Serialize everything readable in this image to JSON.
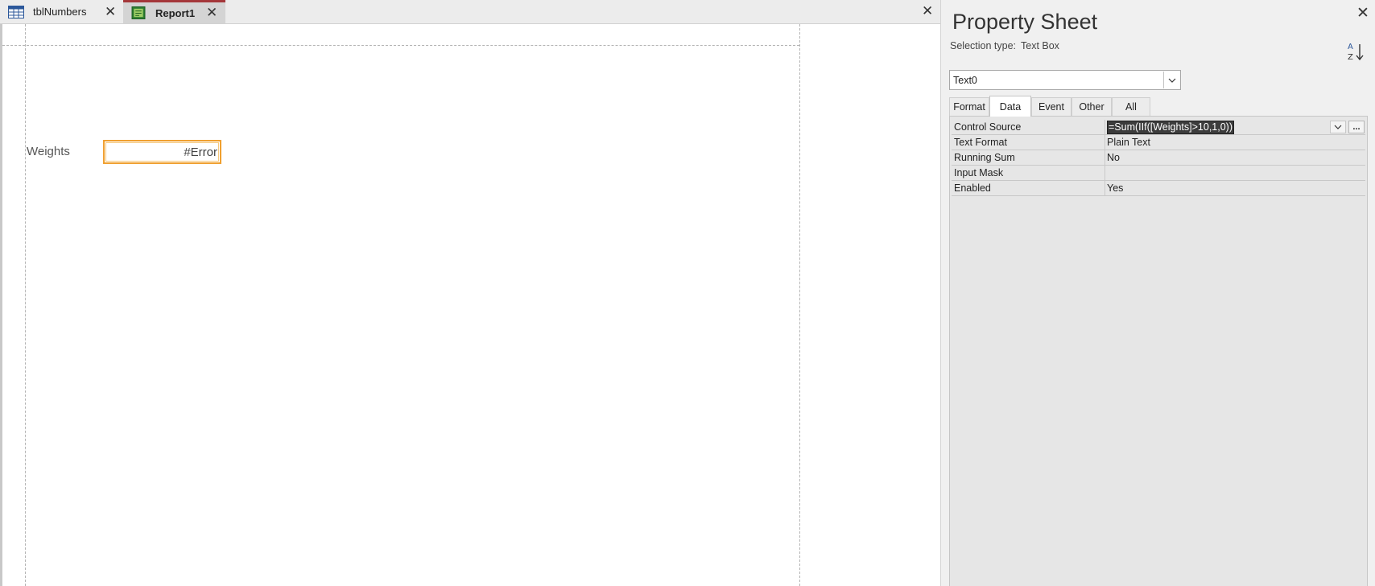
{
  "tabs": [
    {
      "label": "tblNumbers",
      "icon": "table-icon"
    },
    {
      "label": "Report1",
      "icon": "report-icon",
      "active": true
    }
  ],
  "report": {
    "label": "Weights",
    "textbox_value": "#Error"
  },
  "property_sheet": {
    "title": "Property Sheet",
    "selection_label": "Selection type:",
    "selection_type": "Text Box",
    "object_selected": "Text0",
    "tabs": [
      "Format",
      "Data",
      "Event",
      "Other",
      "All"
    ],
    "active_tab": "Data",
    "properties": [
      {
        "name": "Control Source",
        "value": "=Sum(IIf([Weights]>10,1,0))"
      },
      {
        "name": "Text Format",
        "value": "Plain Text"
      },
      {
        "name": "Running Sum",
        "value": "No"
      },
      {
        "name": "Input Mask",
        "value": ""
      },
      {
        "name": "Enabled",
        "value": "Yes"
      }
    ],
    "build_button_label": "..."
  },
  "colors": {
    "active_tab_accent": "#a4373a",
    "selected_control_border": "#f0a030"
  }
}
